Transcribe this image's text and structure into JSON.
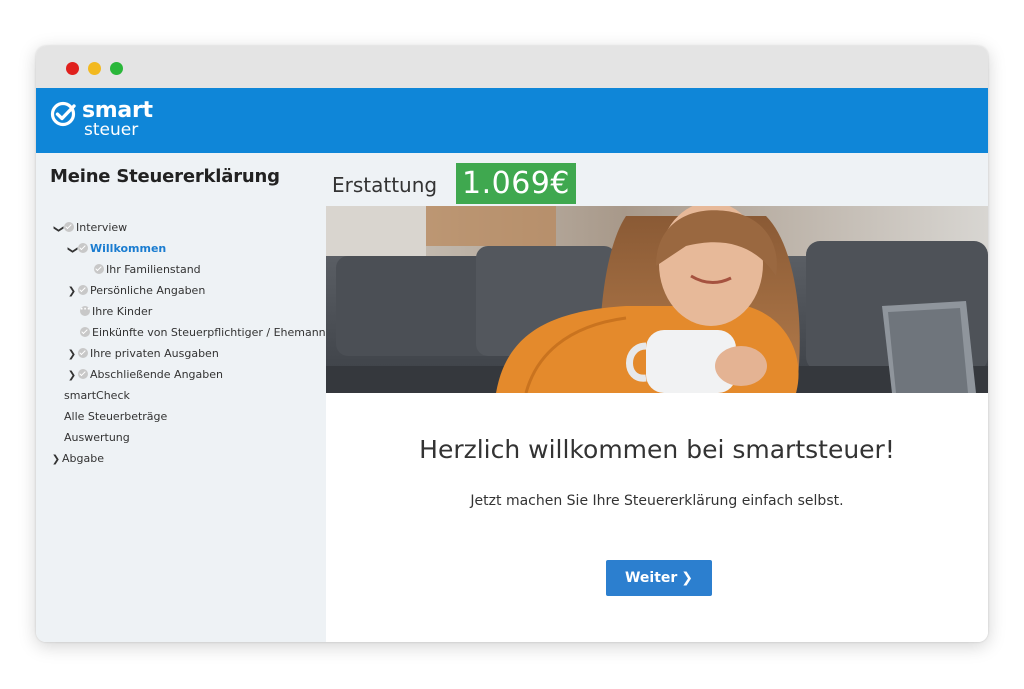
{
  "app": {
    "brand_word": "smart",
    "brand_sub": "steuer",
    "colors": {
      "header": "#0f86d8",
      "refund": "#3fa84f",
      "button": "#2c7fcf",
      "active_link": "#1a7cd0"
    }
  },
  "sidebar": {
    "title": "Meine Steuererklärung",
    "items": [
      {
        "label": "Interview",
        "icon": "check-icon",
        "expand": "open"
      },
      {
        "label": "Willkommen",
        "icon": "check-icon",
        "expand": "open",
        "active": true
      },
      {
        "label": "Ihr Familienstand",
        "icon": "check-icon"
      },
      {
        "label": "Persönliche Angaben",
        "icon": "check-icon",
        "expand": "closed"
      },
      {
        "label": "Ihre Kinder",
        "icon": "dots-icon"
      },
      {
        "label": "Einkünfte von Steuerpflichtiger / Ehemann",
        "icon": "check-icon"
      },
      {
        "label": "Ihre privaten Ausgaben",
        "icon": "check-icon",
        "expand": "closed"
      },
      {
        "label": "Abschließende Angaben",
        "icon": "check-icon",
        "expand": "closed"
      },
      {
        "label": "smartCheck"
      },
      {
        "label": "Alle Steuerbeträge"
      },
      {
        "label": "Auswertung"
      },
      {
        "label": "Abgabe",
        "expand": "closed"
      }
    ]
  },
  "refund": {
    "label": "Erstattung",
    "value": "1.069€"
  },
  "main": {
    "welcome_title": "Herzlich willkommen bei smartsteuer!",
    "welcome_sub": "Jetzt machen Sie Ihre Steuererklärung einfach selbst.",
    "weiter_label": "Weiter"
  }
}
